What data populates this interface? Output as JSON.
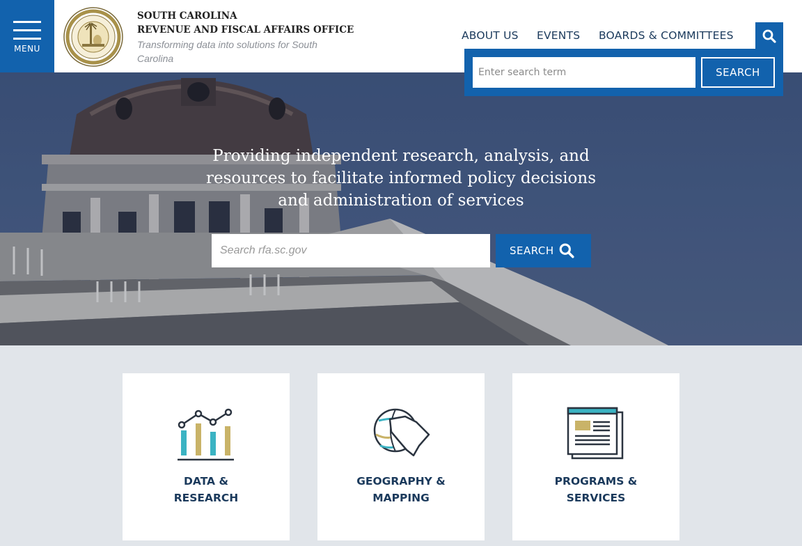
{
  "header": {
    "menu_label": "MENU",
    "brand_line1": "SOUTH CAROLINA",
    "brand_line2": "REVENUE AND FISCAL AFFAIRS OFFICE",
    "tagline": "Transforming data into solutions for South Carolina",
    "nav": [
      {
        "label": "ABOUT US"
      },
      {
        "label": "EVENTS"
      },
      {
        "label": "BOARDS & COMMITTEES"
      }
    ]
  },
  "search_dropdown": {
    "placeholder": "Enter search term",
    "button_label": "SEARCH"
  },
  "hero": {
    "headline": "Providing independent research, analysis, and resources to facilitate informed policy decisions and administration of services",
    "search_placeholder": "Search rfa.sc.gov",
    "search_button": "SEARCH"
  },
  "cards": [
    {
      "title": "DATA &\nRESEARCH",
      "icon": "bar-chart-icon"
    },
    {
      "title": "GEOGRAPHY &\nMAPPING",
      "icon": "globe-map-icon"
    },
    {
      "title": "PROGRAMS &\nSERVICES",
      "icon": "document-icon"
    }
  ],
  "colors": {
    "primary_blue": "#1262ad",
    "navy_text": "#1b3a5c",
    "page_bg": "#e1e5ea",
    "teal_accent": "#3bb3c3",
    "gold_accent": "#c9b368"
  }
}
